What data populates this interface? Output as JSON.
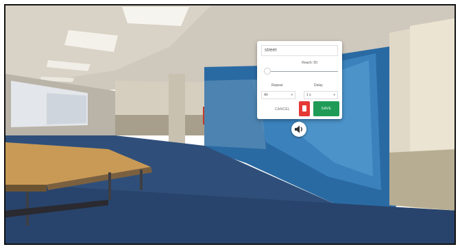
{
  "hotspot_popup": {
    "name_value": "street",
    "reach_label": "Reach: 50",
    "reach_value": 0.05,
    "repeat_label": "Repeat",
    "repeat_value": "All",
    "delay_label": "Delay",
    "delay_value": "1 s",
    "cancel_label": "CANCEL",
    "save_label": "SAVE"
  },
  "icons": {
    "delete": "trash-icon",
    "sound": "speaker-icon"
  },
  "colors": {
    "save": "#1e9c57",
    "delete": "#e53935",
    "floor": "#2f4f7a",
    "glass_tint": "#1e6fb0"
  }
}
